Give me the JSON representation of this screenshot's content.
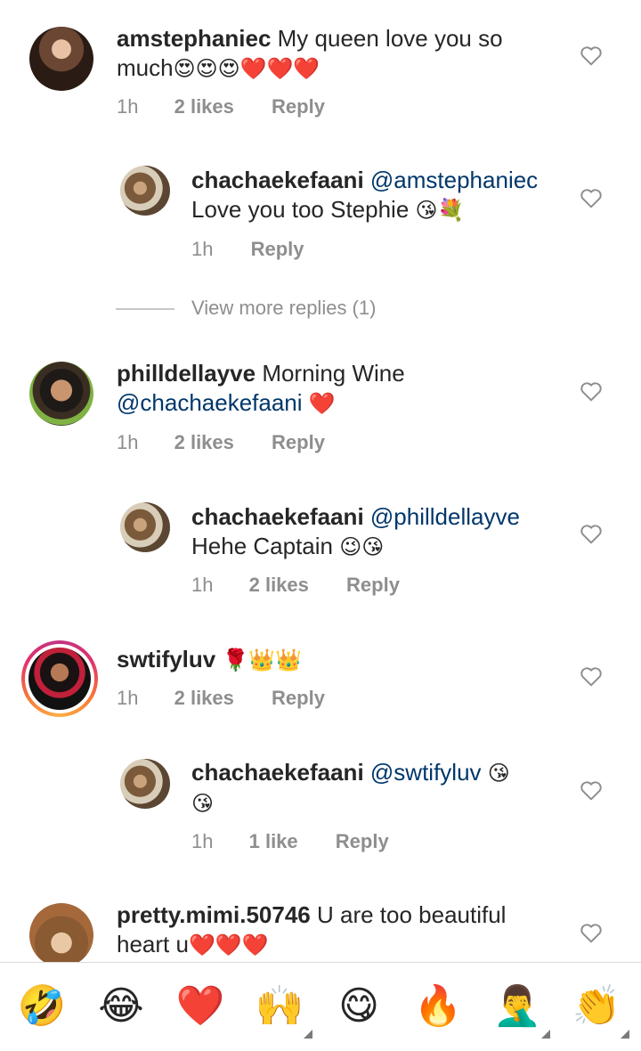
{
  "comments": [
    {
      "username": "amstephaniec",
      "text": "My queen love you so much",
      "emoji": "😍😍😍❤️❤️❤️",
      "time": "1h",
      "likes": "2 likes",
      "reply": "Reply"
    },
    {
      "username": "chachaekefaani",
      "mention": "@amstephaniec",
      "text": "Love you too Stephie",
      "emoji": "😘💐",
      "time": "1h",
      "reply": "Reply"
    },
    {
      "username": "philldellayve",
      "text": "Morning Wine",
      "mention": "@chachaekefaani",
      "emoji": "❤️",
      "time": "1h",
      "likes": "2 likes",
      "reply": "Reply"
    },
    {
      "username": "chachaekefaani",
      "mention": "@philldellayve",
      "text": "Hehe Captain",
      "emoji": "😉😘",
      "time": "1h",
      "likes": "2 likes",
      "reply": "Reply"
    },
    {
      "username": "swtifyluv",
      "emoji": "🌹👑👑",
      "time": "1h",
      "likes": "2 likes",
      "reply": "Reply"
    },
    {
      "username": "chachaekefaani",
      "mention": "@swtifyluv",
      "emoji": "😘",
      "emoji2": "😘",
      "time": "1h",
      "likes": "1 like",
      "reply": "Reply"
    },
    {
      "username": "pretty.mimi.50746",
      "text": "U are too beautiful heart u",
      "emoji": "❤️❤️❤️"
    }
  ],
  "view_more": "View more replies (1)",
  "emoji_bar": [
    "🤣",
    "😂",
    "❤️",
    "🙌",
    "😋",
    "🔥",
    "🤦‍♂️",
    "👏"
  ],
  "colors": {
    "text": "#262626",
    "meta": "#8e8e8e",
    "mention": "#00376b",
    "story_ring": "#e1306c"
  },
  "icons": {
    "like": "heart-outline-icon"
  }
}
